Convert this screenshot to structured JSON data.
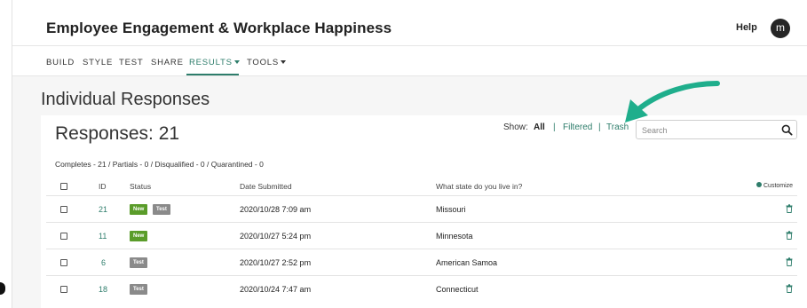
{
  "header": {
    "title": "Employee Engagement & Workplace Happiness",
    "help": "Help",
    "avatar_initial": "m"
  },
  "nav": {
    "items": [
      {
        "label": "BUILD"
      },
      {
        "label": "STYLE"
      },
      {
        "label": "TEST"
      },
      {
        "label": "SHARE"
      },
      {
        "label": "RESULTS",
        "active": true,
        "dropdown": true
      },
      {
        "label": "TOOLS",
        "dropdown": true
      }
    ]
  },
  "page": {
    "title": "Individual Responses",
    "responses_count": "Responses: 21",
    "show_label": "Show:",
    "filter_all": "All",
    "filter_filtered": "Filtered",
    "filter_trash": "Trash",
    "separator": "|",
    "search_placeholder": "Search",
    "completes_summary": "Completes - 21 / Partials - 0 / Disqualified - 0 / Quarantined - 0"
  },
  "table": {
    "headers": {
      "id": "ID",
      "status": "Status",
      "date": "Date Submitted",
      "question": "What state do you live in?",
      "customize": "Customize"
    },
    "rows": [
      {
        "id": "21",
        "badges": [
          "New",
          "Test"
        ],
        "date": "2020/10/28 7:09 am",
        "state": "Missouri"
      },
      {
        "id": "11",
        "badges": [
          "New"
        ],
        "date": "2020/10/27 5:24 pm",
        "state": "Minnesota"
      },
      {
        "id": "6",
        "badges": [
          "Test"
        ],
        "date": "2020/10/27 2:52 pm",
        "state": "American Samoa"
      },
      {
        "id": "18",
        "badges": [
          "Test"
        ],
        "date": "2020/10/24 7:47 am",
        "state": "Connecticut"
      }
    ]
  },
  "colors": {
    "accent": "#2e7d6b",
    "annotation_arrow": "#1fae8c",
    "badge_new": "#5a9c2a",
    "badge_test": "#8a8a8a"
  },
  "icons": {
    "search": "search-icon",
    "trash": "trash-icon",
    "customize": "gear-icon",
    "arrow": "arrow-annotation"
  }
}
